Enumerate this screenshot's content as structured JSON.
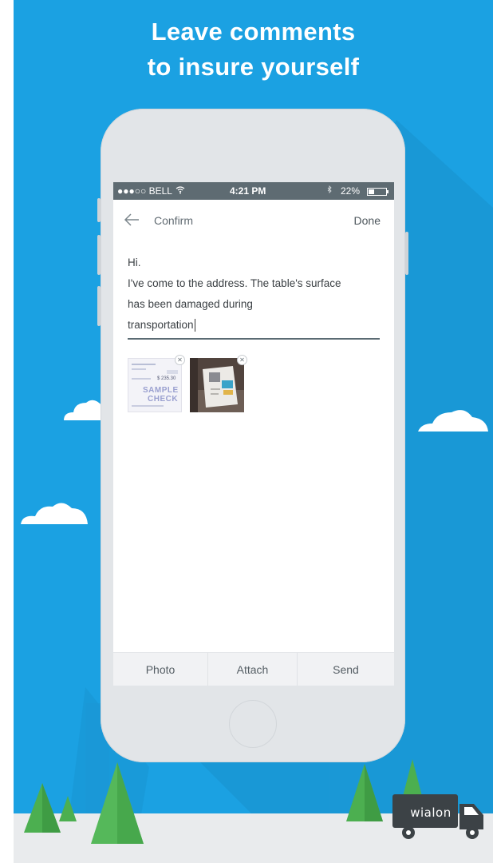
{
  "headline": {
    "line1": "Leave comments",
    "line2": "to insure yourself"
  },
  "status_bar": {
    "carrier": "●●●○○ BELL",
    "time": "4:21 PM",
    "battery": "22%"
  },
  "app_bar": {
    "back_icon": "arrow-left-icon",
    "title": "Confirm",
    "done_label": "Done"
  },
  "message": {
    "line1": "Hi.",
    "line2": "I've come to the address. The table's surface",
    "line3": "has been damaged during",
    "line4": "transportation"
  },
  "attachments": [
    {
      "name": "sample-check",
      "stamp": "SAMPLE",
      "stamp2": "CHECK",
      "amount": "$ 235.30"
    },
    {
      "name": "photo"
    }
  ],
  "bottom_bar": {
    "photo_label": "Photo",
    "attach_label": "Attach",
    "send_label": "Send"
  },
  "brand": {
    "logo_text": "wialon"
  },
  "colors": {
    "sky": "#1ba1e2",
    "status_bar": "#5e6b72",
    "tree": "#4caf50",
    "truck": "#3c4246"
  }
}
